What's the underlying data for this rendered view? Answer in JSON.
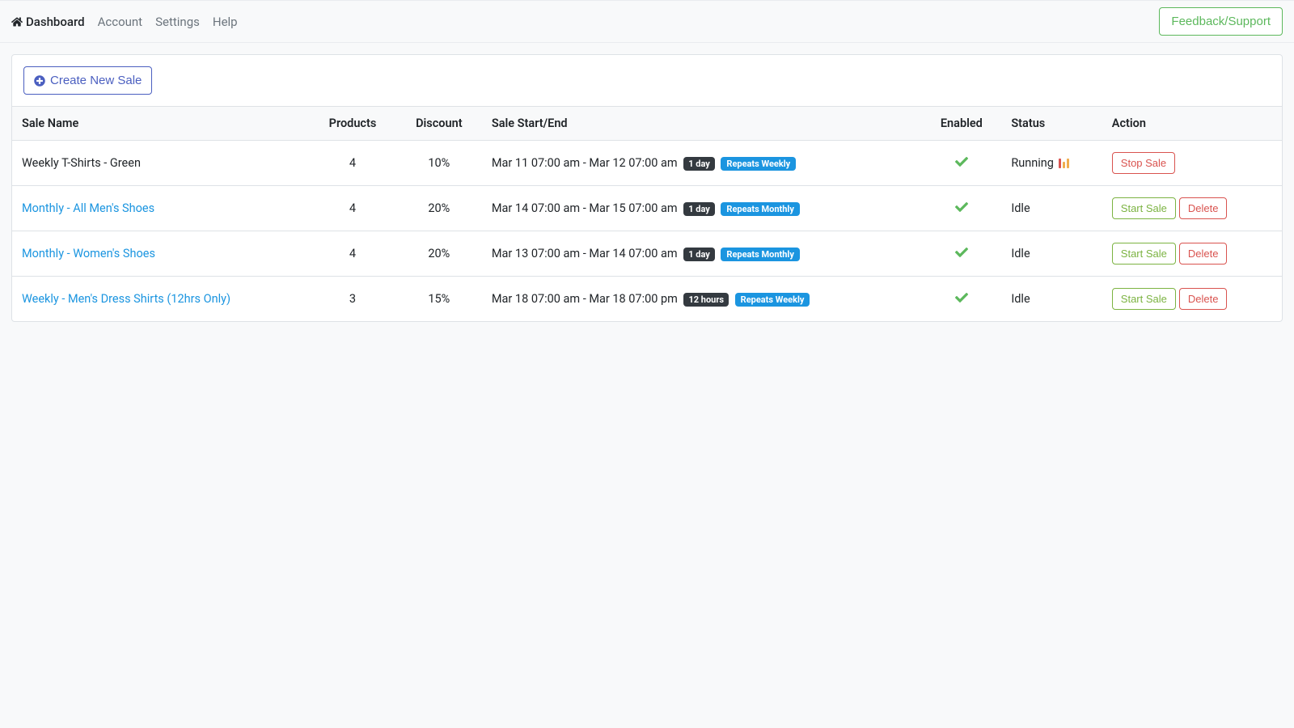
{
  "nav": {
    "dashboard": "Dashboard",
    "account": "Account",
    "settings": "Settings",
    "help": "Help"
  },
  "feedback_btn": "Feedback/Support",
  "create_sale_btn": "Create New Sale",
  "table": {
    "headers": {
      "name": "Sale Name",
      "products": "Products",
      "discount": "Discount",
      "startend": "Sale Start/End",
      "enabled": "Enabled",
      "status": "Status",
      "action": "Action"
    }
  },
  "badges": {
    "repeats_weekly": "Repeats Weekly",
    "repeats_monthly": "Repeats Monthly"
  },
  "actions": {
    "stop": "Stop Sale",
    "start": "Start Sale",
    "delete": "Delete"
  },
  "rows": [
    {
      "name": "Weekly T-Shirts - Green",
      "products": "4",
      "discount": "10%",
      "dates": "Mar 11 07:00 am - Mar 12 07:00 am",
      "duration": "1 day",
      "repeat": "weekly",
      "status": "Running",
      "running": true,
      "link": false
    },
    {
      "name": "Monthly - All Men's Shoes",
      "products": "4",
      "discount": "20%",
      "dates": "Mar 14 07:00 am - Mar 15 07:00 am",
      "duration": "1 day",
      "repeat": "monthly",
      "status": "Idle",
      "running": false,
      "link": true
    },
    {
      "name": "Monthly - Women's Shoes",
      "products": "4",
      "discount": "20%",
      "dates": "Mar 13 07:00 am - Mar 14 07:00 am",
      "duration": "1 day",
      "repeat": "monthly",
      "status": "Idle",
      "running": false,
      "link": true
    },
    {
      "name": "Weekly - Men's Dress Shirts (12hrs Only)",
      "products": "3",
      "discount": "15%",
      "dates": "Mar 18 07:00 am - Mar 18 07:00 pm",
      "duration": "12 hours",
      "repeat": "weekly",
      "status": "Idle",
      "running": false,
      "link": true
    }
  ]
}
